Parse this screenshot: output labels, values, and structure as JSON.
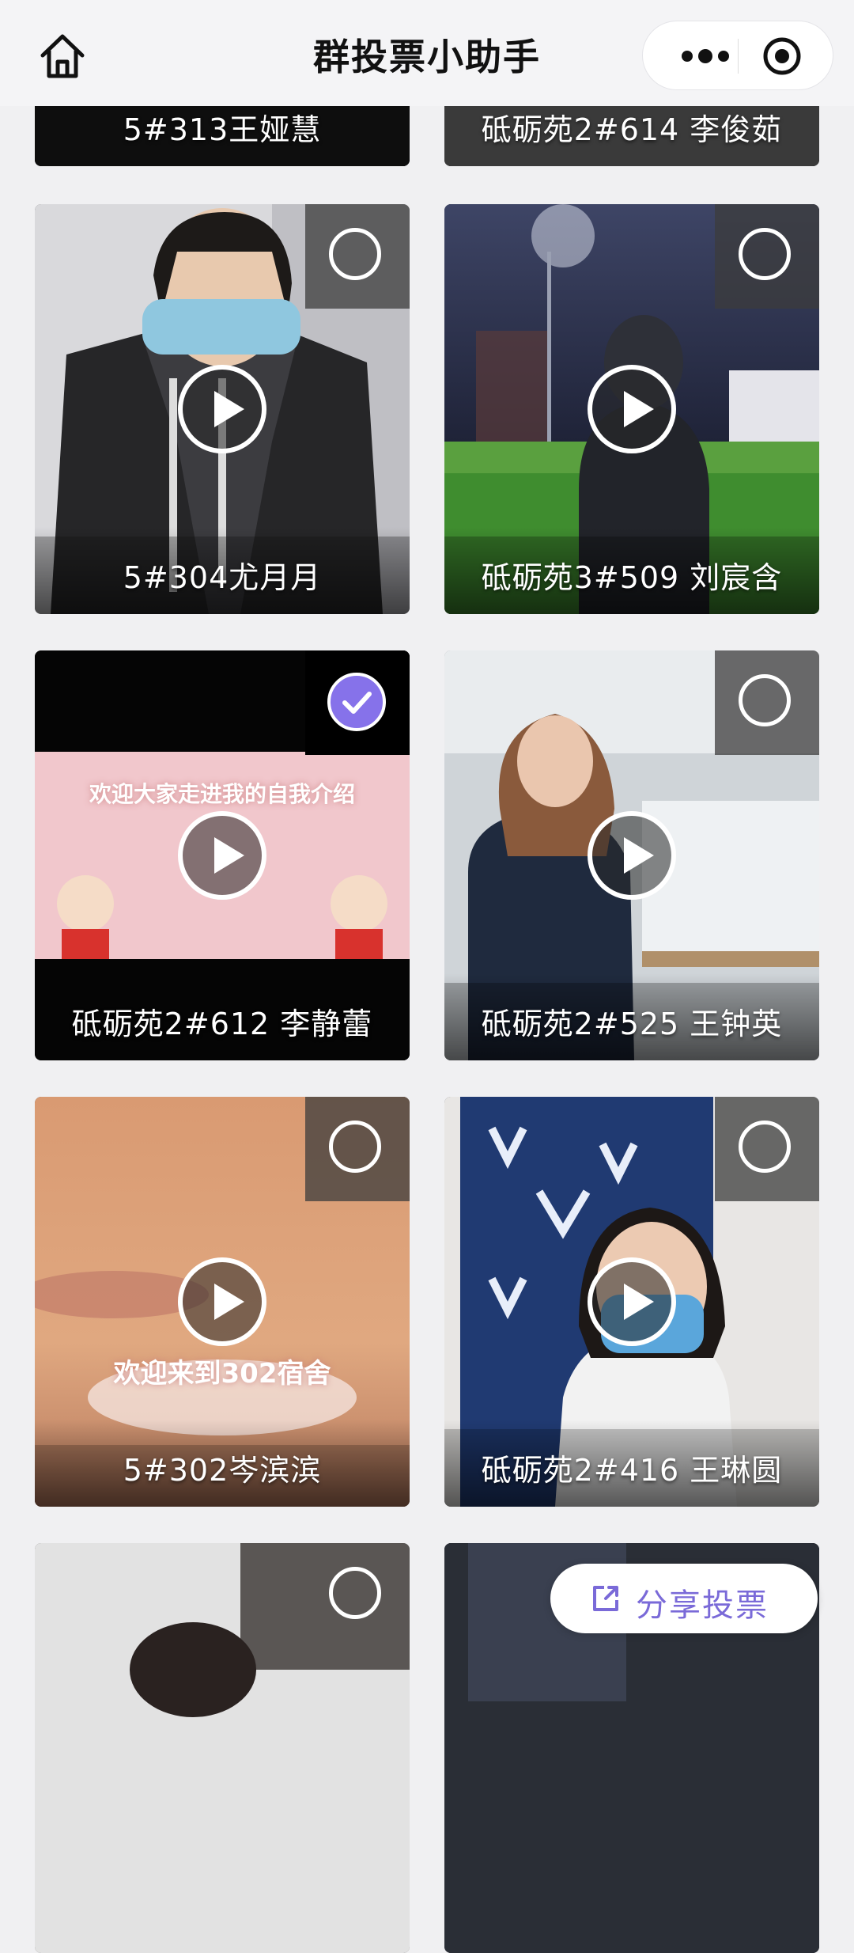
{
  "header": {
    "title": "群投票小助手",
    "home_icon": "home-icon",
    "more_icon": "more-dots-icon",
    "close_icon": "target-circle-icon"
  },
  "cards": [
    {
      "label": "5#313王娅慧",
      "selected": false
    },
    {
      "label": "砥砺苑2#614 李俊茹",
      "selected": false
    },
    {
      "label": "5#304尤月月",
      "selected": false
    },
    {
      "label": "砥砺苑3#509 刘宸含",
      "selected": false
    },
    {
      "label": "砥砺苑2#612 李静蕾",
      "selected": true,
      "overlay": "欢迎大家走进我的自我介绍"
    },
    {
      "label": "砥砺苑2#525 王钟英",
      "selected": false
    },
    {
      "label": "5#302岑滨滨",
      "selected": false,
      "overlay": "欢迎来到302宿舍"
    },
    {
      "label": "砥砺苑2#416 王琳圆",
      "selected": false
    },
    {
      "label": "",
      "selected": false
    },
    {
      "label": "",
      "selected": false
    }
  ],
  "share": {
    "label": "分享投票",
    "icon": "share-external-icon"
  },
  "colors": {
    "accent": "#8672ea",
    "share_text": "#7a6ad8"
  }
}
